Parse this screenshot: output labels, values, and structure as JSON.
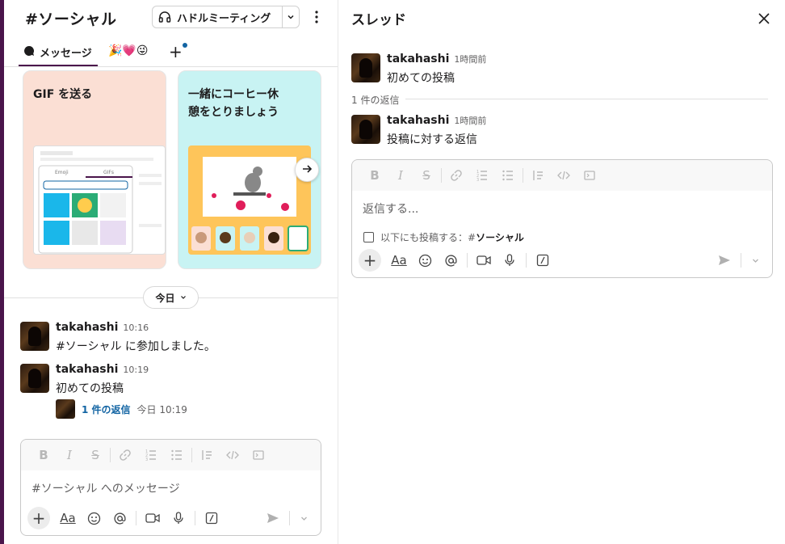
{
  "channel": {
    "title": "#ソーシャル",
    "huddle_label": "ハドルミーティング",
    "tabs": [
      {
        "label": "メッセージ"
      },
      {
        "label": "🎉💗😜"
      }
    ],
    "add_tab": "+",
    "cards": [
      {
        "title": "GIF を送る"
      },
      {
        "title": "一緒にコーヒー休\n憩をとりましょう"
      }
    ],
    "date_pill": "今日",
    "messages": [
      {
        "author": "takahashi",
        "time": "10:16",
        "text": "#ソーシャル に参加しました。"
      },
      {
        "author": "takahashi",
        "time": "10:19",
        "text": "初めての投稿"
      }
    ],
    "reply_summary": {
      "link": "1 件の返信",
      "time": "今日 10:19"
    },
    "composer_placeholder": "#ソーシャル へのメッセージ"
  },
  "thread": {
    "title": "スレッド",
    "parent": {
      "author": "takahashi",
      "time": "1時間前",
      "text": "初めての投稿"
    },
    "replies_count": "1 件の返信",
    "reply": {
      "author": "takahashi",
      "time": "1時間前",
      "text": "投稿に対する返信"
    },
    "composer_placeholder": "返信する...",
    "also_send_prefix": "以下にも投稿する：#",
    "also_send_channel": "ソーシャル"
  },
  "composer_toolbar": {
    "bold": "B",
    "italic": "I",
    "strike": "S",
    "format_text": "Aa"
  },
  "colors": {
    "aubergine": "#4a154b",
    "link": "#1264a3",
    "muted": "#616061"
  }
}
